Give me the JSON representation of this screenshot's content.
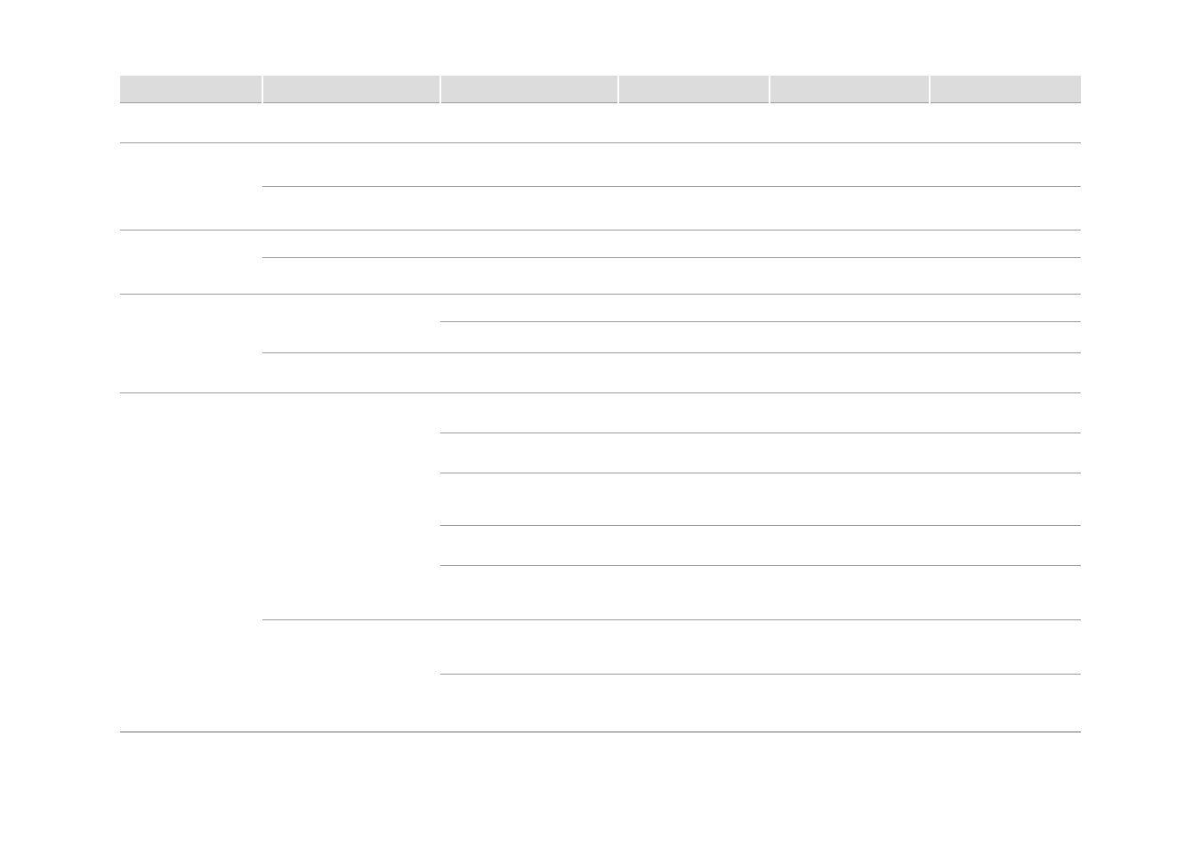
{
  "table": {
    "headers": [
      "",
      "",
      "",
      "",
      "",
      ""
    ],
    "rows": [
      {
        "h": "h44",
        "cells": [
          "",
          "",
          "",
          "",
          "",
          ""
        ],
        "merge_c1": false,
        "merge_c2": false
      },
      {
        "h": "h48",
        "cells": [
          "",
          "",
          "",
          "",
          "",
          ""
        ],
        "merge_c1": true,
        "merge_c2": false
      },
      {
        "h": "h48",
        "cells": [
          "",
          "",
          "",
          "",
          "",
          ""
        ],
        "merge_c1": false,
        "merge_c2": false
      },
      {
        "h": "h30",
        "cells": [
          "",
          "",
          "",
          "",
          "",
          ""
        ],
        "merge_c1": true,
        "merge_c2": false
      },
      {
        "h": "h40",
        "cells": [
          "",
          "",
          "",
          "",
          "",
          ""
        ],
        "merge_c1": false,
        "merge_c2": false
      },
      {
        "h": "h30",
        "cells": [
          "",
          "",
          "",
          "",
          "",
          ""
        ],
        "merge_c1": true,
        "merge_c2": true
      },
      {
        "h": "h34",
        "cells": [
          "",
          "",
          "",
          "",
          "",
          ""
        ],
        "merge_c1": true,
        "merge_c2": false
      },
      {
        "h": "h44",
        "cells": [
          "",
          "",
          "",
          "",
          "",
          ""
        ],
        "merge_c1": false,
        "merge_c2": false
      },
      {
        "h": "h44",
        "cells": [
          "",
          "",
          "",
          "",
          "",
          ""
        ],
        "merge_c1": true,
        "merge_c2": true
      },
      {
        "h": "h44",
        "cells": [
          "",
          "",
          "",
          "",
          "",
          ""
        ],
        "merge_c1": true,
        "merge_c2": true
      },
      {
        "h": "h58",
        "cells": [
          "",
          "",
          "",
          "",
          "",
          ""
        ],
        "merge_c1": true,
        "merge_c2": true
      },
      {
        "h": "h44",
        "cells": [
          "",
          "",
          "",
          "",
          "",
          ""
        ],
        "merge_c1": true,
        "merge_c2": true
      },
      {
        "h": "h60",
        "cells": [
          "",
          "",
          "",
          "",
          "",
          ""
        ],
        "merge_c1": true,
        "merge_c2": false
      },
      {
        "h": "h60",
        "cells": [
          "",
          "",
          "",
          "",
          "",
          ""
        ],
        "merge_c1": true,
        "merge_c2": true
      },
      {
        "h": "h64",
        "cells": [
          "",
          "",
          "",
          "",
          "",
          ""
        ],
        "merge_c1": false,
        "merge_c2": false
      }
    ]
  }
}
